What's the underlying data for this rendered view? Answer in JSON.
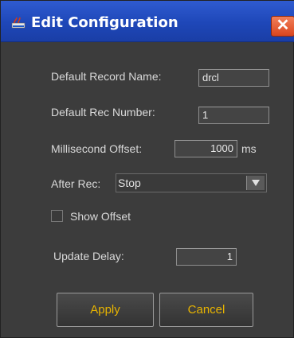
{
  "window": {
    "title": "Edit Configuration",
    "close_glyph": "✕"
  },
  "form": {
    "record_name_label": "Default Record Name:",
    "record_name_value": "drcl",
    "rec_number_label": "Default Rec Number:",
    "rec_number_value": "1",
    "ms_offset_label": "Millisecond Offset:",
    "ms_offset_value": "1000",
    "ms_unit": "ms",
    "after_rec_label": "After Rec:",
    "after_rec_value": "Stop",
    "show_offset_label": "Show Offset",
    "show_offset_checked": false,
    "update_delay_label": "Update Delay:",
    "update_delay_value": "1"
  },
  "buttons": {
    "apply": "Apply",
    "cancel": "Cancel"
  },
  "colors": {
    "titlebar": "#1e47b8",
    "button_text": "#e8b400",
    "dialog_bg": "#3c3c3c"
  }
}
